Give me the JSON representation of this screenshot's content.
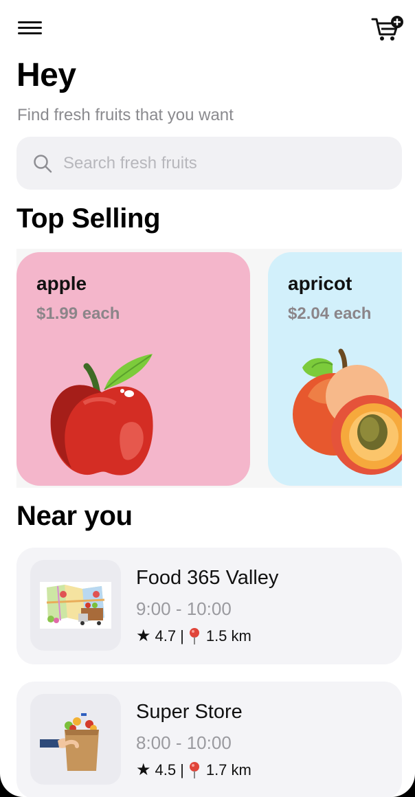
{
  "header": {
    "menu_icon": "hamburger-menu-icon",
    "cart_icon": "cart-plus-icon"
  },
  "greeting": {
    "title": "Hey",
    "subtitle": "Find fresh fruits that you want"
  },
  "search": {
    "placeholder": "Search fresh fruits",
    "value": "",
    "icon": "search-icon"
  },
  "top_selling": {
    "title": "Top Selling",
    "items": [
      {
        "name": "apple",
        "price": "$1.99 each",
        "color": "#f4b6cb"
      },
      {
        "name": "apricot",
        "price": "$2.04 each",
        "color": "#d2f0fb"
      }
    ]
  },
  "near_you": {
    "title": "Near you",
    "stores": [
      {
        "name": "Food 365 Valley",
        "hours": "9:00 - 10:00",
        "rating": "4.7",
        "distance": "1.5 km"
      },
      {
        "name": "Super Store",
        "hours": "8:00 - 10:00",
        "rating": "4.5",
        "distance": "1.7 km"
      }
    ]
  },
  "colors": {
    "accent_text": "#000000",
    "muted": "#8a8a8e",
    "card_bg": "#f4f4f7"
  }
}
